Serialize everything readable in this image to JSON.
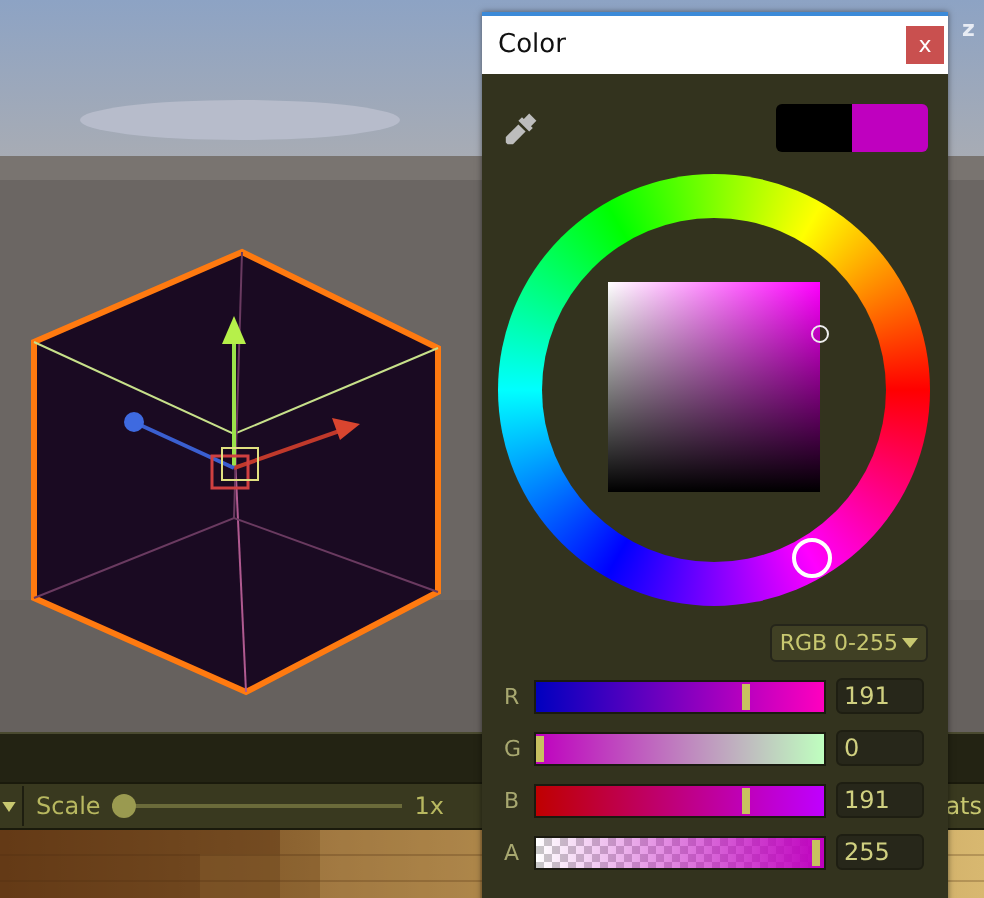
{
  "scene": {
    "axis_label": "z"
  },
  "toolbar": {
    "scale_label": "Scale",
    "scale_slider": {
      "level": 0
    },
    "scale_value": "1x",
    "right_text": "ats"
  },
  "color_window": {
    "title": "Color",
    "close": "x",
    "swatches": [
      {
        "color": "#000000"
      },
      {
        "color": "#bf00bf"
      }
    ],
    "mode": "RGB 0-255",
    "channels": [
      {
        "kind": "r",
        "label": "R",
        "level": 0.749,
        "value": "191"
      },
      {
        "kind": "g",
        "label": "G",
        "level": 0,
        "value": "0"
      },
      {
        "kind": "b",
        "label": "B",
        "level": 0.749,
        "value": "191"
      },
      {
        "kind": "a",
        "label": "A",
        "level": 1,
        "value": "255"
      }
    ]
  }
}
